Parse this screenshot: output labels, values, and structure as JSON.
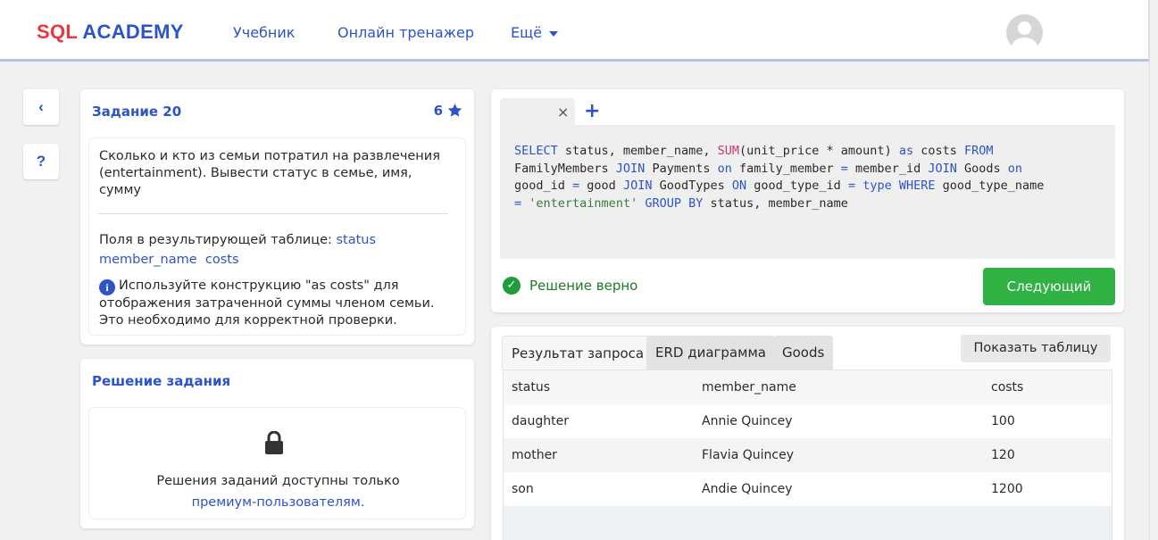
{
  "header": {
    "logo_part1": "SQL",
    "logo_part2": "ACADEMY",
    "nav": [
      "Учебник",
      "Онлайн тренажер",
      "Ещё"
    ]
  },
  "sidebar": {
    "back_label": "‹",
    "help_label": "?"
  },
  "task": {
    "title": "Задание 20",
    "score": "6",
    "description": "Сколько и кто из семьи потратил на развлечения (entertainment). Вывести статус в семье, имя, сумму",
    "fields_prefix": "Поля в результирующей таблице:",
    "fields": [
      "status",
      "member_name",
      "costs"
    ],
    "hint": "Используйте конструкцию \"as costs\" для отображения затраченной суммы членом семьи. Это необходимо для корректной проверки."
  },
  "solution": {
    "title": "Решение задания",
    "text": "Решения заданий доступны только",
    "link": "премиум-пользователям."
  },
  "editor": {
    "tab_close": "×",
    "tab_add": "+",
    "code_tokens": [
      [
        "kw",
        "SELECT"
      ],
      [
        "t",
        " status, member_name, "
      ],
      [
        "fn",
        "SUM"
      ],
      [
        "t",
        "(unit_price "
      ],
      [
        "t",
        "*"
      ],
      [
        "t",
        " amount) "
      ],
      [
        "kw",
        "as"
      ],
      [
        "t",
        " costs "
      ],
      [
        "kw",
        "FROM"
      ],
      [
        "br",
        ""
      ],
      [
        "t",
        "FamilyMembers "
      ],
      [
        "kw",
        "JOIN"
      ],
      [
        "t",
        " Payments "
      ],
      [
        "kw",
        "on"
      ],
      [
        "t",
        " family_member "
      ],
      [
        "kw",
        "="
      ],
      [
        "t",
        " member_id "
      ],
      [
        "kw",
        "JOIN"
      ],
      [
        "t",
        " Goods "
      ],
      [
        "kw",
        "on"
      ],
      [
        "br",
        ""
      ],
      [
        "t",
        "good_id "
      ],
      [
        "kw",
        "="
      ],
      [
        "t",
        " good "
      ],
      [
        "kw",
        "JOIN"
      ],
      [
        "t",
        " GoodTypes "
      ],
      [
        "kw",
        "ON"
      ],
      [
        "t",
        " good_type_id "
      ],
      [
        "kw",
        "="
      ],
      [
        "t",
        " "
      ],
      [
        "kw",
        "type"
      ],
      [
        "t",
        " "
      ],
      [
        "kw",
        "WHERE"
      ],
      [
        "t",
        " good_type_name"
      ],
      [
        "br",
        ""
      ],
      [
        "kw",
        "="
      ],
      [
        "t",
        " "
      ],
      [
        "str",
        "'entertainment'"
      ],
      [
        "t",
        " "
      ],
      [
        "kw",
        "GROUP BY"
      ],
      [
        "t",
        " status, member_name"
      ]
    ],
    "status": "Решение верно",
    "next_button": "Следующий"
  },
  "result": {
    "tabs": [
      "Результат запроса",
      "ERD диаграмма",
      "Goods"
    ],
    "show_table_button": "Показать таблицу",
    "columns": [
      "status",
      "member_name",
      "costs"
    ],
    "rows": [
      [
        "daughter",
        "Annie Quincey",
        "100"
      ],
      [
        "mother",
        "Flavia Quincey",
        "120"
      ],
      [
        "son",
        "Andie Quincey",
        "1200"
      ]
    ]
  }
}
